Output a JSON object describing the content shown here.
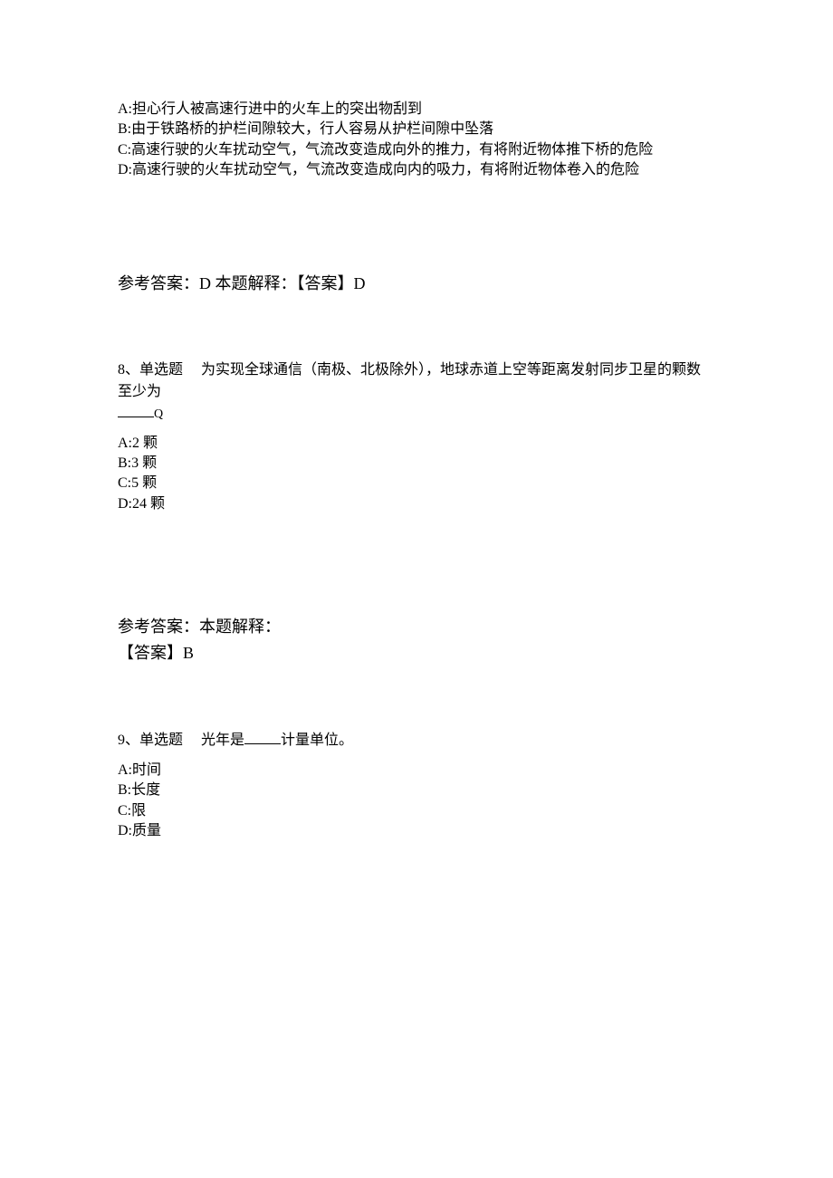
{
  "q7": {
    "optionA": "A:担心行人被高速行进中的火车上的突出物刮到",
    "optionB": "B:由于铁路桥的护栏间隙较大，行人容易从护栏间隙中坠落",
    "optionC": "C:高速行驶的火车扰动空气，气流改变造成向外的推力，有将附近物体推下桥的危险",
    "optionD": "D:高速行驶的火车扰动空气，气流改变造成向内的吸力，有将附近物体卷入的危险",
    "answer": "参考答案：D 本题解释：【答案】D"
  },
  "q8": {
    "number": "8、",
    "type": "单选题",
    "text_part1": "为实现全球通信（南极、北极除外），地球赤道上空等距离发射同步卫星的颗数至少为",
    "small_q": "Q",
    "optionA": "A:2 颗",
    "optionB": "B:3 颗",
    "optionC": "C:5 颗",
    "optionD": "D:24 颗",
    "answer_line1": "参考答案：本题解释：",
    "answer_line2": "【答案】B"
  },
  "q9": {
    "number": "9、",
    "type": "单选题",
    "text_before": "光年是",
    "text_after": "计量单位。",
    "optionA": "A:时间",
    "optionB": "B:长度",
    "optionC": "C:限",
    "optionD": "D:质量"
  }
}
